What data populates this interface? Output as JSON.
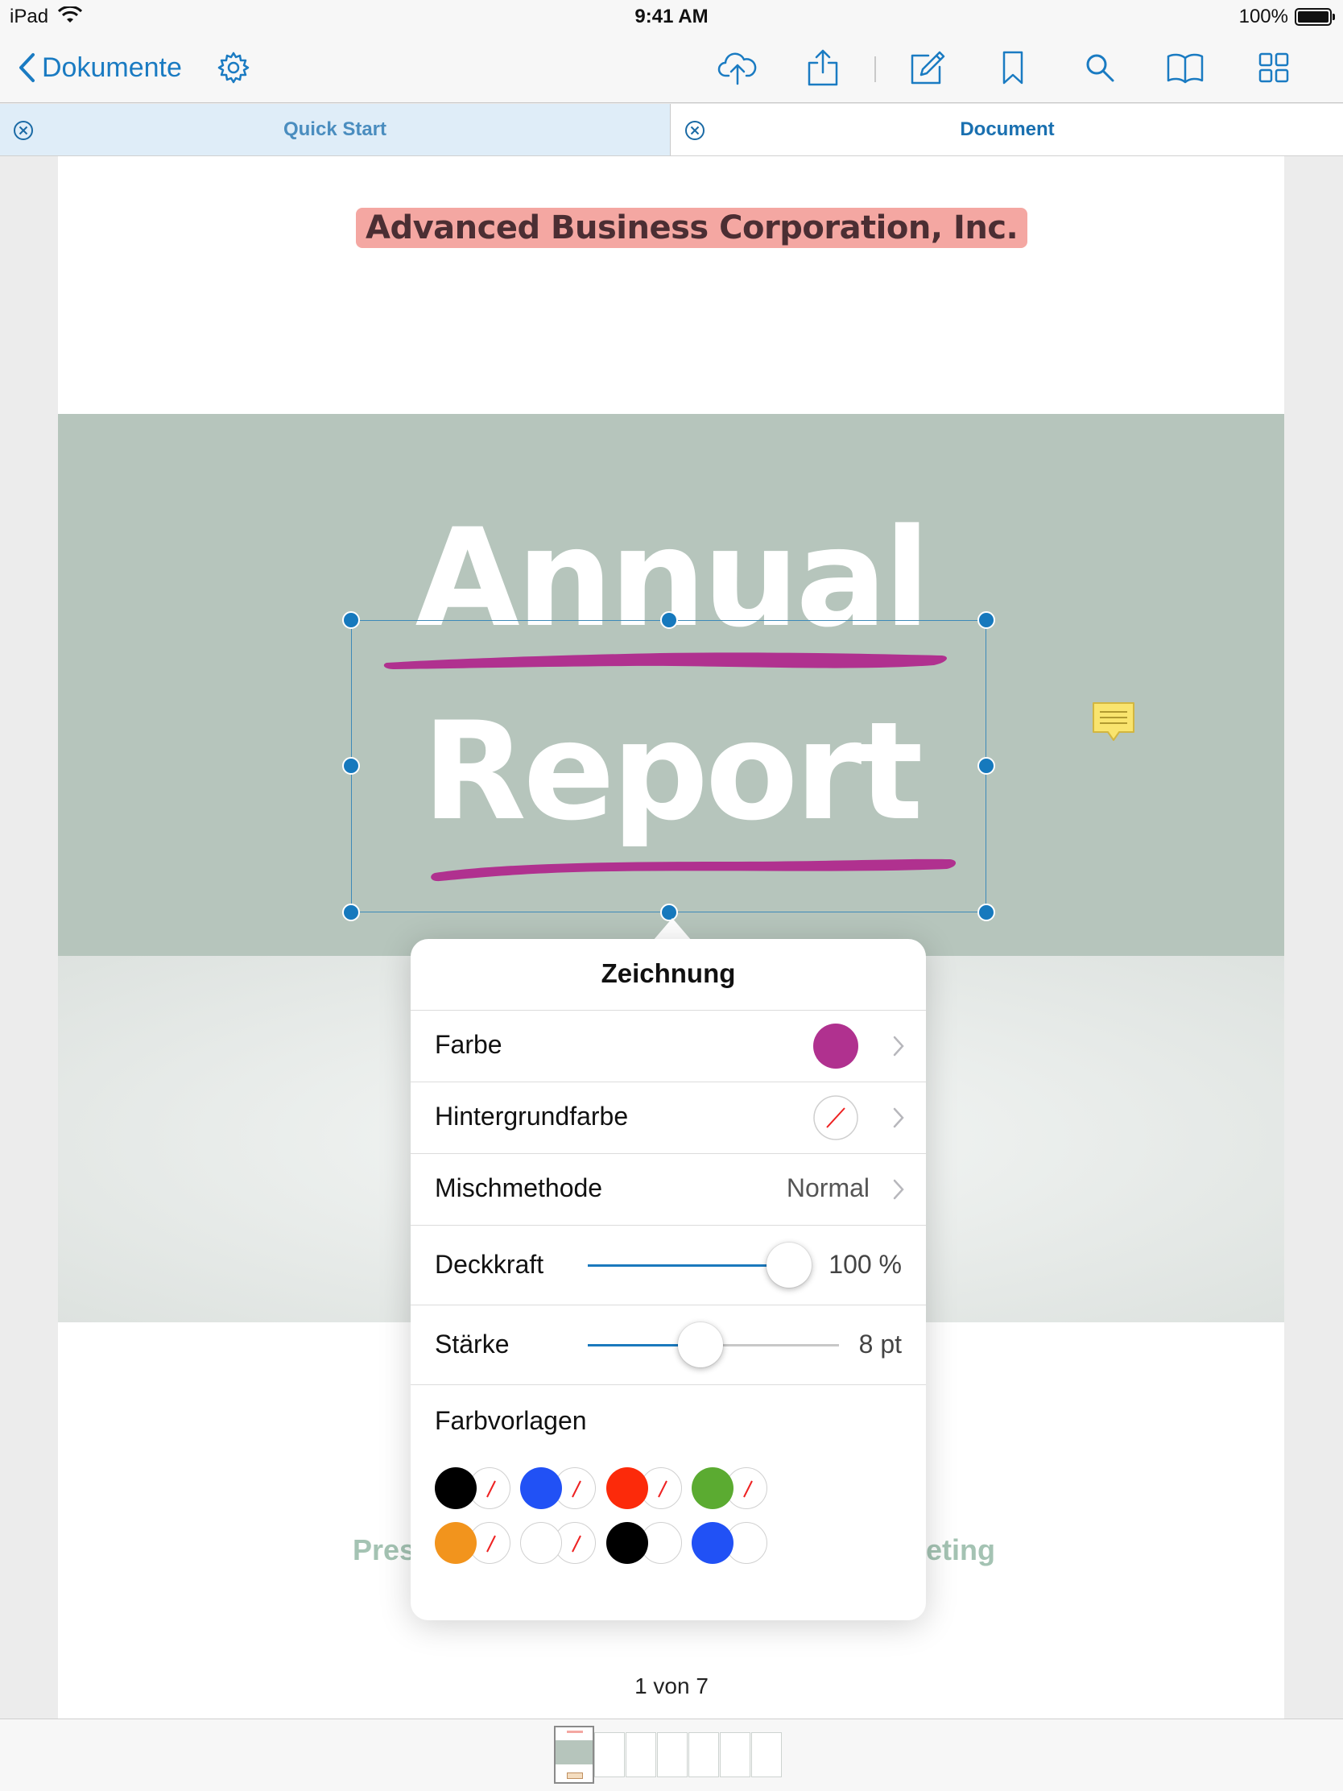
{
  "status_bar": {
    "carrier": "iPad",
    "time": "9:41 AM",
    "battery": "100%"
  },
  "nav": {
    "back_label": "Dokumente",
    "icons": [
      "gear-icon",
      "cloud-upload-icon",
      "share-icon",
      "edit-icon",
      "bookmark-icon",
      "search-icon",
      "book-icon",
      "grid-icon"
    ]
  },
  "tabs": [
    {
      "label": "Quick Start",
      "active": false
    },
    {
      "label": "Document",
      "active": true
    }
  ],
  "document": {
    "company": "Advanced Business Corporation, Inc.",
    "title_line1": "Annual",
    "title_line2": "Report",
    "faded_left": "Pres",
    "faded_right": "eting",
    "ink_color": "#b0318f"
  },
  "popover": {
    "title": "Zeichnung",
    "farbe_label": "Farbe",
    "farbe_color": "#b0318f",
    "hintergrund_label": "Hintergrundfarbe",
    "mischmethode_label": "Mischmethode",
    "mischmethode_value": "Normal",
    "deckkraft_label": "Deckkraft",
    "deckkraft_value": "100 %",
    "deckkraft_level": 1.0,
    "staerke_label": "Stärke",
    "staerke_value": "8 pt",
    "staerke_level": 0.45,
    "farbvorlagen_label": "Farbvorlagen",
    "presets": [
      {
        "fg": "#000000",
        "bg": "none"
      },
      {
        "fg": "#2151f5",
        "bg": "none"
      },
      {
        "fg": "#fc2a0a",
        "bg": "none"
      },
      {
        "fg": "#5bab31",
        "bg": "none"
      },
      {
        "fg": "#f2941d",
        "bg": "none"
      },
      {
        "fg": "#ffffff",
        "bg": "none"
      },
      {
        "fg": "#000000",
        "bg": "#ffffff"
      },
      {
        "fg": "#2151f5",
        "bg": "#ffffff"
      }
    ]
  },
  "page_counter": "1 von 7",
  "thumbnail_count": 7,
  "accent_color": "#1a7bc2"
}
